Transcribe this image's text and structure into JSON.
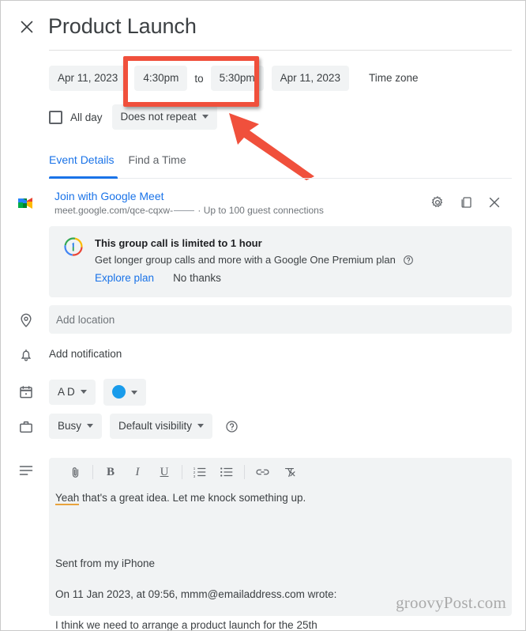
{
  "window": {
    "title": "Product Launch",
    "close_icon": "close-icon"
  },
  "schedule": {
    "start_date": "Apr 11, 2023",
    "start_time": "4:30pm",
    "separator": "to",
    "end_time": "5:30pm",
    "end_date": "Apr 11, 2023",
    "time_zone_label": "Time zone",
    "all_day_label": "All day",
    "all_day_checked": false,
    "recurrence": "Does not repeat"
  },
  "annotation": {
    "highlight_color": "#f0503c",
    "arrow_color": "#f0503c",
    "highlight_target": "time-fields"
  },
  "tabs": [
    {
      "label": "Event Details",
      "active": true
    },
    {
      "label": "Find a Time",
      "active": false
    }
  ],
  "meet": {
    "icon": "google-meet-icon",
    "join_label": "Join with Google Meet",
    "url": "meet.google.com/qce-cqxw-",
    "guest_note": "· Up to 100 guest connections",
    "actions": [
      {
        "icon": "gear-icon",
        "name": "meet-settings-button"
      },
      {
        "icon": "copy-icon",
        "name": "copy-meet-link-button"
      },
      {
        "icon": "close-icon",
        "name": "remove-meet-button"
      }
    ]
  },
  "promo": {
    "logo": "google-one-icon",
    "title": "This group call is limited to 1 hour",
    "subtitle": "Get longer group calls and more with a Google One Premium plan",
    "help_icon": "help-circle-icon",
    "primary_action": "Explore plan",
    "secondary_action": "No thanks"
  },
  "location": {
    "icon": "location-pin-icon",
    "placeholder": "Add location"
  },
  "notification": {
    "icon": "bell-icon",
    "label": "Add notification"
  },
  "calendar_row": {
    "icon": "calendar-icon",
    "calendar_name": "A D",
    "color_swatch": "#1a9ceb"
  },
  "availability_row": {
    "icon": "briefcase-icon",
    "busy_label": "Busy",
    "visibility_label": "Default visibility",
    "help_icon": "help-circle-icon"
  },
  "description": {
    "icon": "description-lines-icon",
    "toolbar": [
      {
        "name": "attach-file-button",
        "icon": "paperclip-icon",
        "glyph": ""
      },
      {
        "name": "bold-button",
        "icon": "bold-icon",
        "glyph": "B"
      },
      {
        "name": "italic-button",
        "icon": "italic-icon",
        "glyph": "I"
      },
      {
        "name": "underline-button",
        "icon": "underline-icon",
        "glyph": "U"
      },
      {
        "name": "numbered-list-button",
        "icon": "numbered-list-icon",
        "glyph": ""
      },
      {
        "name": "bulleted-list-button",
        "icon": "bulleted-list-icon",
        "glyph": ""
      },
      {
        "name": "insert-link-button",
        "icon": "link-icon",
        "glyph": ""
      },
      {
        "name": "remove-formatting-button",
        "icon": "remove-formatting-icon",
        "glyph": ""
      }
    ],
    "body": {
      "line1_spellcheck_word": "Yeah",
      "line1_rest": " that's a great idea. Let me knock something up.",
      "line2": "Sent from my iPhone",
      "line3": "On 11 Jan 2023, at 09:56, mmm@emailaddress.com wrote:",
      "line4": "I think we need to arrange a product launch for the 25th"
    }
  },
  "watermark": "groovyPost.com"
}
